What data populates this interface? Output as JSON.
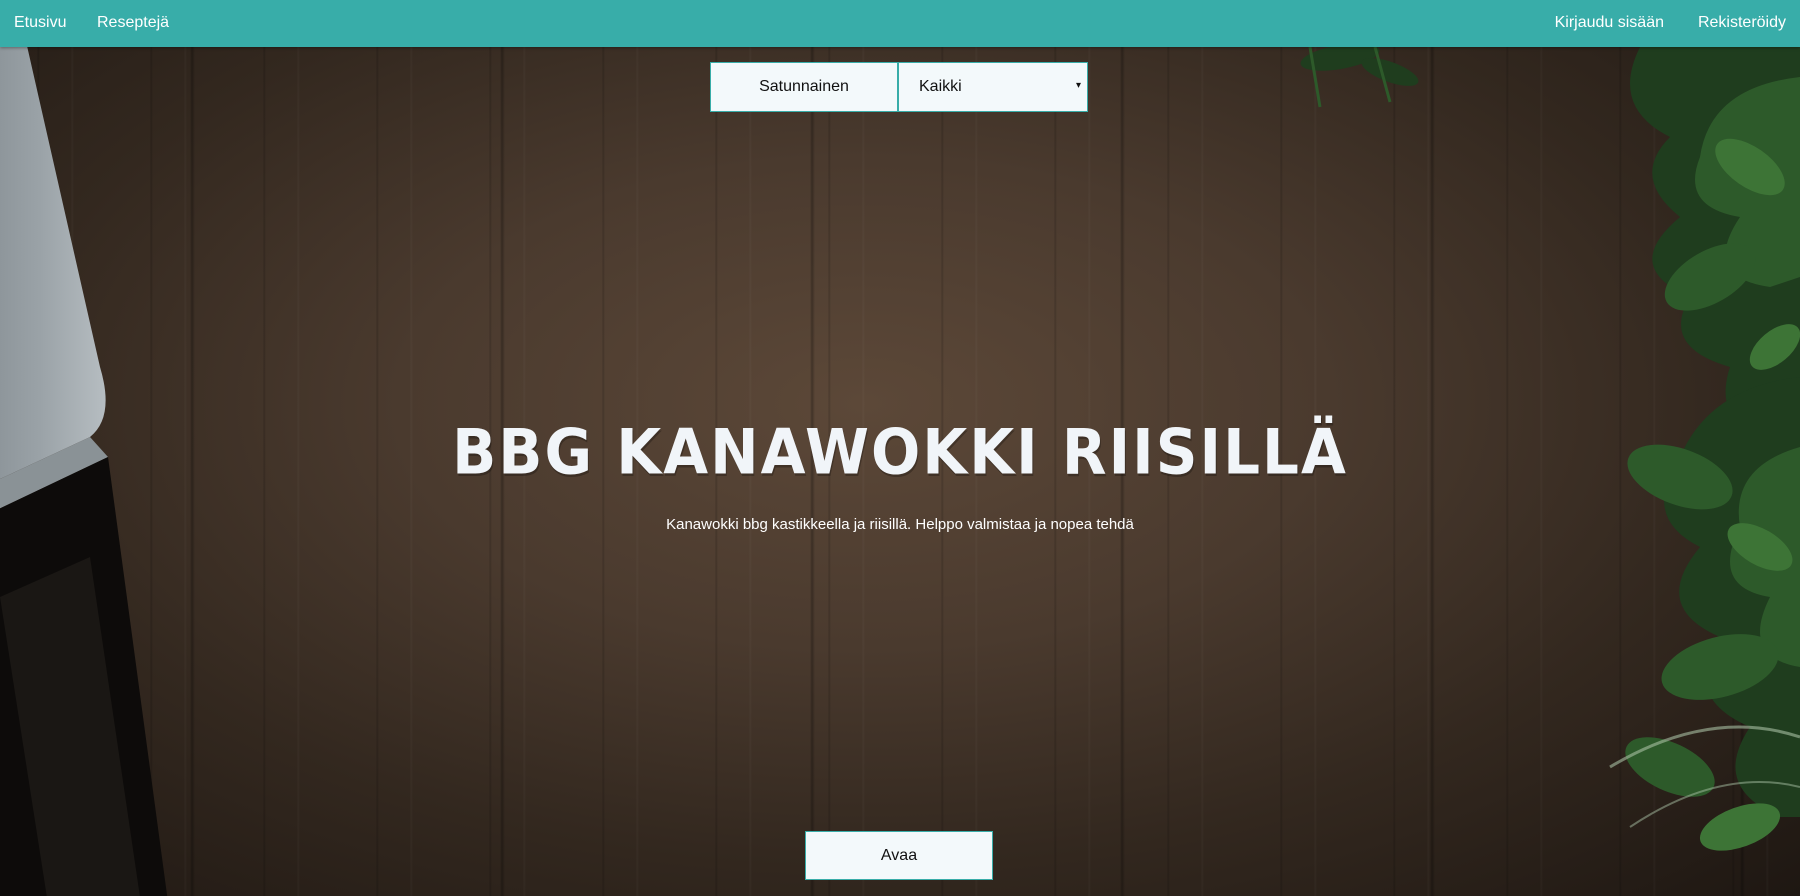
{
  "nav": {
    "home": "Etusivu",
    "recipes": "Reseptejä",
    "login": "Kirjaudu sisään",
    "register": "Rekisteröidy"
  },
  "controls": {
    "random_label": "Satunnainen",
    "category_selected": "Kaikki",
    "category_arrow": "▾"
  },
  "recipe": {
    "title": "BBG Kanawokki riisillä",
    "description": "Kanawokki bbg kastikkeella ja riisillä. Helppo valmistaa ja nopea tehdä",
    "open_label": "Avaa"
  },
  "colors": {
    "navbar": "#38ada9",
    "button_bg": "#f3f9fb",
    "wood": "#4a3a2e"
  }
}
